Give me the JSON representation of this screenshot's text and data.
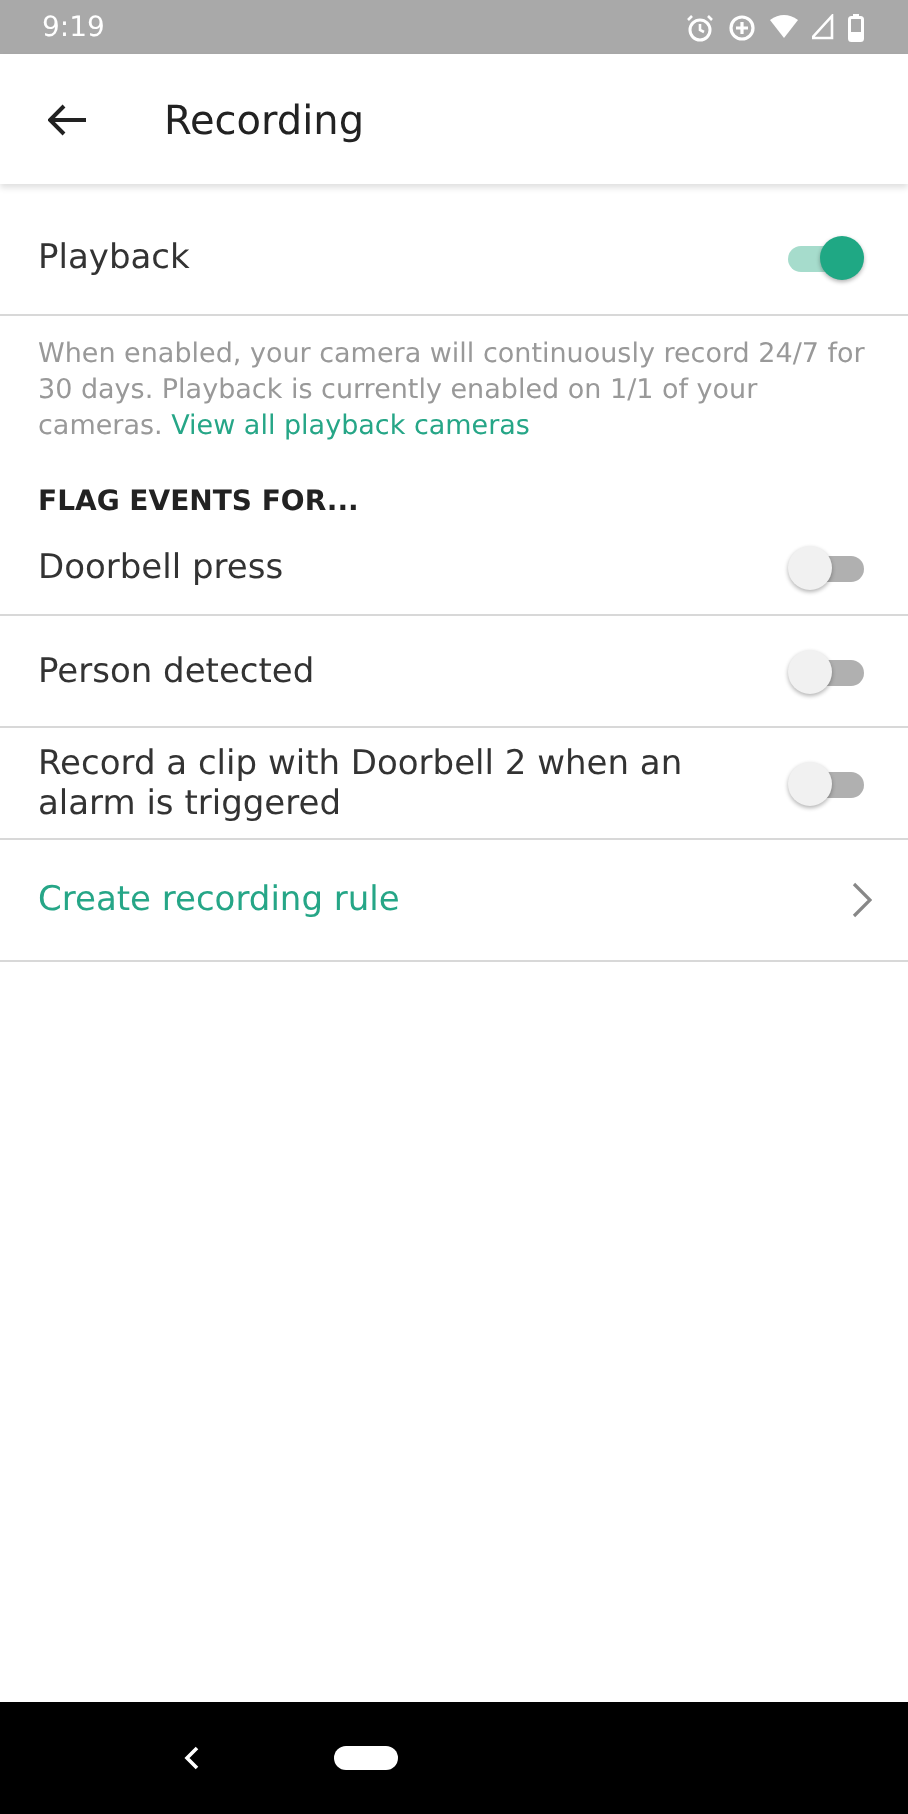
{
  "status_bar": {
    "time": "9:19"
  },
  "app_bar": {
    "title": "Recording"
  },
  "playback": {
    "label": "Playback",
    "on": true
  },
  "description": {
    "text": "When enabled, your camera will continuously record 24/7 for 30 days. Playback is currently enabled on 1/1 of your cameras. ",
    "link": "View all playback cameras"
  },
  "section": {
    "title": "FLAG EVENTS FOR...",
    "items": [
      {
        "kind": "toggle",
        "label": "Doorbell press",
        "on": false
      },
      {
        "kind": "toggle",
        "label": "Person detected",
        "on": false
      },
      {
        "kind": "toggle",
        "label": "Record a clip with Doorbell 2 when an alarm is triggered",
        "on": false
      },
      {
        "kind": "link",
        "label": "Create recording rule"
      }
    ]
  }
}
